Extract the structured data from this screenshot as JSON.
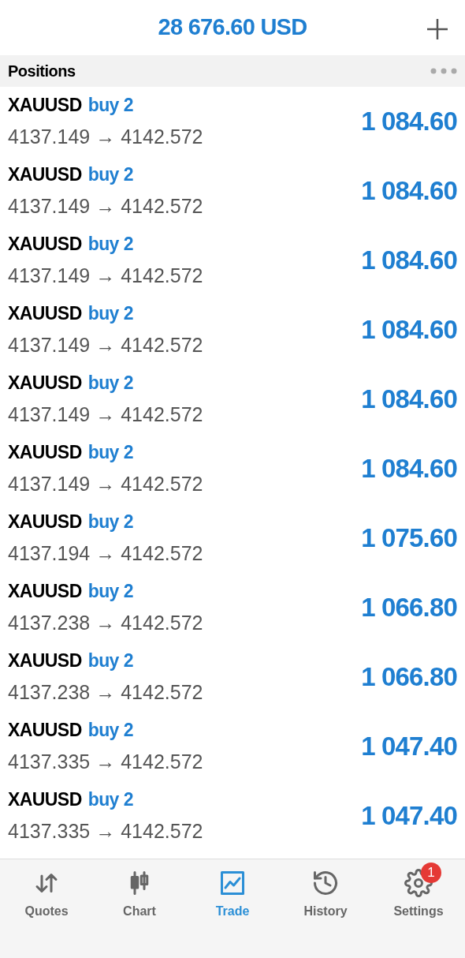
{
  "header": {
    "balance": "28 676.60 USD"
  },
  "section": {
    "title": "Positions"
  },
  "positions": [
    {
      "symbol": "XAUUSD",
      "side": "buy 2",
      "prices": "4137.149 → 4142.572",
      "profit": "1 084.60"
    },
    {
      "symbol": "XAUUSD",
      "side": "buy 2",
      "prices": "4137.149 → 4142.572",
      "profit": "1 084.60"
    },
    {
      "symbol": "XAUUSD",
      "side": "buy 2",
      "prices": "4137.149 → 4142.572",
      "profit": "1 084.60"
    },
    {
      "symbol": "XAUUSD",
      "side": "buy 2",
      "prices": "4137.149 → 4142.572",
      "profit": "1 084.60"
    },
    {
      "symbol": "XAUUSD",
      "side": "buy 2",
      "prices": "4137.149 → 4142.572",
      "profit": "1 084.60"
    },
    {
      "symbol": "XAUUSD",
      "side": "buy 2",
      "prices": "4137.149 → 4142.572",
      "profit": "1 084.60"
    },
    {
      "symbol": "XAUUSD",
      "side": "buy 2",
      "prices": "4137.194 → 4142.572",
      "profit": "1 075.60"
    },
    {
      "symbol": "XAUUSD",
      "side": "buy 2",
      "prices": "4137.238 → 4142.572",
      "profit": "1 066.80"
    },
    {
      "symbol": "XAUUSD",
      "side": "buy 2",
      "prices": "4137.238 → 4142.572",
      "profit": "1 066.80"
    },
    {
      "symbol": "XAUUSD",
      "side": "buy 2",
      "prices": "4137.335 → 4142.572",
      "profit": "1 047.40"
    },
    {
      "symbol": "XAUUSD",
      "side": "buy 2",
      "prices": "4137.335 → 4142.572",
      "profit": "1 047.40"
    }
  ],
  "tabs": [
    {
      "kind": "quotes",
      "label": "Quotes",
      "selected": false
    },
    {
      "kind": "chart",
      "label": "Chart",
      "selected": false
    },
    {
      "kind": "trade",
      "label": "Trade",
      "selected": true
    },
    {
      "kind": "history",
      "label": "History",
      "selected": false
    },
    {
      "kind": "settings",
      "label": "Settings",
      "selected": false,
      "badge": "1"
    }
  ]
}
